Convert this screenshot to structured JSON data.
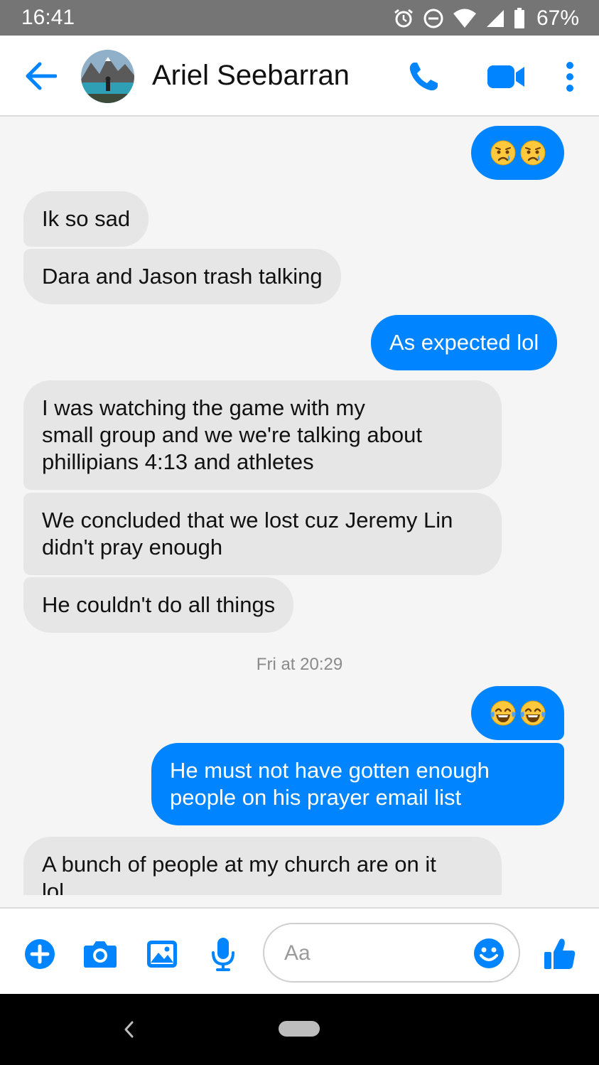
{
  "status_bar": {
    "time": "16:41",
    "battery": "67%",
    "icons": [
      "alarm-icon",
      "do-not-disturb-icon",
      "wifi-icon",
      "signal-icon",
      "battery-icon"
    ]
  },
  "header": {
    "contact_name": "Ariel Seebarran",
    "icons": [
      "back-arrow-icon",
      "phone-icon",
      "video-camera-icon",
      "more-vertical-icon"
    ]
  },
  "messages": [
    {
      "side": "out",
      "emoji": [
        "crying-face",
        "crying-face"
      ]
    },
    {
      "side": "in",
      "text": "Ik so sad"
    },
    {
      "side": "in",
      "text": "Dara and Jason trash talking"
    },
    {
      "side": "out",
      "text": "As expected lol"
    },
    {
      "side": "in",
      "lines": [
        "I was watching the game with my",
        "small group and we we're talking about",
        "phillipians 4:13 and athletes"
      ]
    },
    {
      "side": "in",
      "lines": [
        "We concluded that we lost cuz Jeremy Lin",
        "didn't pray enough"
      ]
    },
    {
      "side": "in",
      "text": "He couldn't do all things"
    },
    {
      "timestamp": "Fri at 20:29"
    },
    {
      "side": "out",
      "emoji": [
        "tears-of-joy-face",
        "tears-of-joy-face"
      ]
    },
    {
      "side": "out",
      "lines": [
        "He must not have gotten enough",
        "people on his prayer email list"
      ]
    },
    {
      "side": "in",
      "lines": [
        "A bunch of people at my church are on it",
        "lol"
      ]
    }
  ],
  "composer": {
    "placeholder": "Aa",
    "icons": [
      "plus-icon",
      "camera-icon",
      "image-icon",
      "microphone-icon",
      "emoji-icon",
      "thumbs-up-icon"
    ]
  },
  "colors": {
    "accent": "#0084ff",
    "incoming_bubble": "#e6e6e6",
    "status_bar": "#757575"
  }
}
